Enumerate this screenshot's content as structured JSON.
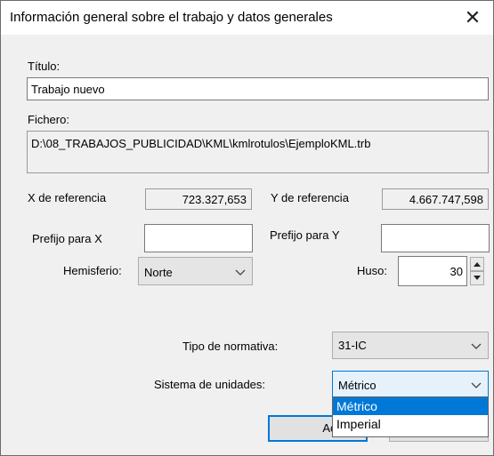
{
  "window": {
    "title": "Información general sobre el trabajo y datos generales",
    "close_glyph": "✕"
  },
  "titulo": {
    "label": "Título:",
    "value": "Trabajo nuevo"
  },
  "fichero": {
    "label": "Fichero:",
    "value": "D:\\08_TRABAJOS_PUBLICIDAD\\KML\\kmlrotulos\\EjemploKML.trb"
  },
  "x_ref": {
    "label": "X de referencia",
    "value": "723.327,653"
  },
  "y_ref": {
    "label": "Y de referencia",
    "value": "4.667.747,598"
  },
  "prefijo_x": {
    "label": "Prefijo para X",
    "value": ""
  },
  "prefijo_y": {
    "label": "Prefijo para Y",
    "value": ""
  },
  "hemisferio": {
    "label": "Hemisferio:",
    "value": "Norte"
  },
  "huso": {
    "label": "Huso:",
    "value": "30"
  },
  "normativa": {
    "label": "Tipo de normativa:",
    "value": "31-IC"
  },
  "unidades": {
    "label": "Sistema de unidades:",
    "value": "Métrico",
    "options": [
      "Métrico",
      "Imperial"
    ]
  },
  "buttons": {
    "accept_label": "Acept"
  },
  "colors": {
    "selection": "#0078d7",
    "focus_border": "#0078d7"
  }
}
